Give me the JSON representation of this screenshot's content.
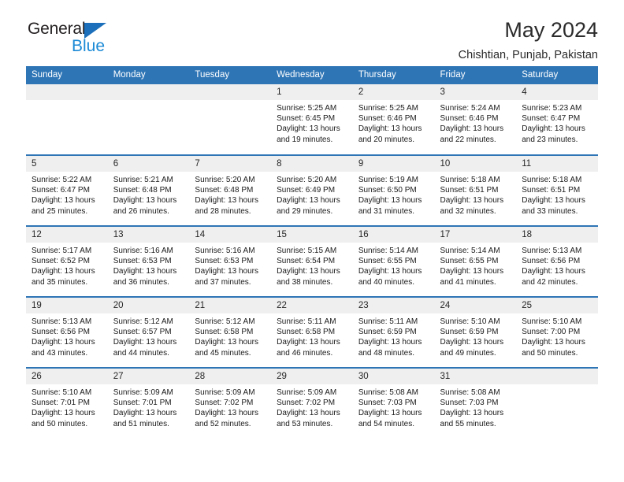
{
  "brand": {
    "name_top": "General",
    "name_bottom": "Blue",
    "triangle_color": "#1c6fba",
    "blue_text_color": "#1c8ad6"
  },
  "header": {
    "title": "May 2024",
    "location": "Chishtian, Punjab, Pakistan"
  },
  "theme": {
    "header_blue": "#2e75b6",
    "daynum_background": "#efefef",
    "text_color": "#1a1a1a"
  },
  "weekday_headers": [
    "Sunday",
    "Monday",
    "Tuesday",
    "Wednesday",
    "Thursday",
    "Friday",
    "Saturday"
  ],
  "labels": {
    "sunrise_prefix": "Sunrise:",
    "sunset_prefix": "Sunset:",
    "daylight_prefix": "Daylight:"
  },
  "weeks": [
    [
      {
        "day": "",
        "empty": true
      },
      {
        "day": "",
        "empty": true
      },
      {
        "day": "",
        "empty": true
      },
      {
        "day": "1",
        "sunrise": "Sunrise: 5:25 AM",
        "sunset": "Sunset: 6:45 PM",
        "daylight_line1": "Daylight: 13 hours",
        "daylight_line2": "and 19 minutes."
      },
      {
        "day": "2",
        "sunrise": "Sunrise: 5:25 AM",
        "sunset": "Sunset: 6:46 PM",
        "daylight_line1": "Daylight: 13 hours",
        "daylight_line2": "and 20 minutes."
      },
      {
        "day": "3",
        "sunrise": "Sunrise: 5:24 AM",
        "sunset": "Sunset: 6:46 PM",
        "daylight_line1": "Daylight: 13 hours",
        "daylight_line2": "and 22 minutes."
      },
      {
        "day": "4",
        "sunrise": "Sunrise: 5:23 AM",
        "sunset": "Sunset: 6:47 PM",
        "daylight_line1": "Daylight: 13 hours",
        "daylight_line2": "and 23 minutes."
      }
    ],
    [
      {
        "day": "5",
        "sunrise": "Sunrise: 5:22 AM",
        "sunset": "Sunset: 6:47 PM",
        "daylight_line1": "Daylight: 13 hours",
        "daylight_line2": "and 25 minutes."
      },
      {
        "day": "6",
        "sunrise": "Sunrise: 5:21 AM",
        "sunset": "Sunset: 6:48 PM",
        "daylight_line1": "Daylight: 13 hours",
        "daylight_line2": "and 26 minutes."
      },
      {
        "day": "7",
        "sunrise": "Sunrise: 5:20 AM",
        "sunset": "Sunset: 6:48 PM",
        "daylight_line1": "Daylight: 13 hours",
        "daylight_line2": "and 28 minutes."
      },
      {
        "day": "8",
        "sunrise": "Sunrise: 5:20 AM",
        "sunset": "Sunset: 6:49 PM",
        "daylight_line1": "Daylight: 13 hours",
        "daylight_line2": "and 29 minutes."
      },
      {
        "day": "9",
        "sunrise": "Sunrise: 5:19 AM",
        "sunset": "Sunset: 6:50 PM",
        "daylight_line1": "Daylight: 13 hours",
        "daylight_line2": "and 31 minutes."
      },
      {
        "day": "10",
        "sunrise": "Sunrise: 5:18 AM",
        "sunset": "Sunset: 6:51 PM",
        "daylight_line1": "Daylight: 13 hours",
        "daylight_line2": "and 32 minutes."
      },
      {
        "day": "11",
        "sunrise": "Sunrise: 5:18 AM",
        "sunset": "Sunset: 6:51 PM",
        "daylight_line1": "Daylight: 13 hours",
        "daylight_line2": "and 33 minutes."
      }
    ],
    [
      {
        "day": "12",
        "sunrise": "Sunrise: 5:17 AM",
        "sunset": "Sunset: 6:52 PM",
        "daylight_line1": "Daylight: 13 hours",
        "daylight_line2": "and 35 minutes."
      },
      {
        "day": "13",
        "sunrise": "Sunrise: 5:16 AM",
        "sunset": "Sunset: 6:53 PM",
        "daylight_line1": "Daylight: 13 hours",
        "daylight_line2": "and 36 minutes."
      },
      {
        "day": "14",
        "sunrise": "Sunrise: 5:16 AM",
        "sunset": "Sunset: 6:53 PM",
        "daylight_line1": "Daylight: 13 hours",
        "daylight_line2": "and 37 minutes."
      },
      {
        "day": "15",
        "sunrise": "Sunrise: 5:15 AM",
        "sunset": "Sunset: 6:54 PM",
        "daylight_line1": "Daylight: 13 hours",
        "daylight_line2": "and 38 minutes."
      },
      {
        "day": "16",
        "sunrise": "Sunrise: 5:14 AM",
        "sunset": "Sunset: 6:55 PM",
        "daylight_line1": "Daylight: 13 hours",
        "daylight_line2": "and 40 minutes."
      },
      {
        "day": "17",
        "sunrise": "Sunrise: 5:14 AM",
        "sunset": "Sunset: 6:55 PM",
        "daylight_line1": "Daylight: 13 hours",
        "daylight_line2": "and 41 minutes."
      },
      {
        "day": "18",
        "sunrise": "Sunrise: 5:13 AM",
        "sunset": "Sunset: 6:56 PM",
        "daylight_line1": "Daylight: 13 hours",
        "daylight_line2": "and 42 minutes."
      }
    ],
    [
      {
        "day": "19",
        "sunrise": "Sunrise: 5:13 AM",
        "sunset": "Sunset: 6:56 PM",
        "daylight_line1": "Daylight: 13 hours",
        "daylight_line2": "and 43 minutes."
      },
      {
        "day": "20",
        "sunrise": "Sunrise: 5:12 AM",
        "sunset": "Sunset: 6:57 PM",
        "daylight_line1": "Daylight: 13 hours",
        "daylight_line2": "and 44 minutes."
      },
      {
        "day": "21",
        "sunrise": "Sunrise: 5:12 AM",
        "sunset": "Sunset: 6:58 PM",
        "daylight_line1": "Daylight: 13 hours",
        "daylight_line2": "and 45 minutes."
      },
      {
        "day": "22",
        "sunrise": "Sunrise: 5:11 AM",
        "sunset": "Sunset: 6:58 PM",
        "daylight_line1": "Daylight: 13 hours",
        "daylight_line2": "and 46 minutes."
      },
      {
        "day": "23",
        "sunrise": "Sunrise: 5:11 AM",
        "sunset": "Sunset: 6:59 PM",
        "daylight_line1": "Daylight: 13 hours",
        "daylight_line2": "and 48 minutes."
      },
      {
        "day": "24",
        "sunrise": "Sunrise: 5:10 AM",
        "sunset": "Sunset: 6:59 PM",
        "daylight_line1": "Daylight: 13 hours",
        "daylight_line2": "and 49 minutes."
      },
      {
        "day": "25",
        "sunrise": "Sunrise: 5:10 AM",
        "sunset": "Sunset: 7:00 PM",
        "daylight_line1": "Daylight: 13 hours",
        "daylight_line2": "and 50 minutes."
      }
    ],
    [
      {
        "day": "26",
        "sunrise": "Sunrise: 5:10 AM",
        "sunset": "Sunset: 7:01 PM",
        "daylight_line1": "Daylight: 13 hours",
        "daylight_line2": "and 50 minutes."
      },
      {
        "day": "27",
        "sunrise": "Sunrise: 5:09 AM",
        "sunset": "Sunset: 7:01 PM",
        "daylight_line1": "Daylight: 13 hours",
        "daylight_line2": "and 51 minutes."
      },
      {
        "day": "28",
        "sunrise": "Sunrise: 5:09 AM",
        "sunset": "Sunset: 7:02 PM",
        "daylight_line1": "Daylight: 13 hours",
        "daylight_line2": "and 52 minutes."
      },
      {
        "day": "29",
        "sunrise": "Sunrise: 5:09 AM",
        "sunset": "Sunset: 7:02 PM",
        "daylight_line1": "Daylight: 13 hours",
        "daylight_line2": "and 53 minutes."
      },
      {
        "day": "30",
        "sunrise": "Sunrise: 5:08 AM",
        "sunset": "Sunset: 7:03 PM",
        "daylight_line1": "Daylight: 13 hours",
        "daylight_line2": "and 54 minutes."
      },
      {
        "day": "31",
        "sunrise": "Sunrise: 5:08 AM",
        "sunset": "Sunset: 7:03 PM",
        "daylight_line1": "Daylight: 13 hours",
        "daylight_line2": "and 55 minutes."
      },
      {
        "day": "",
        "empty": true
      }
    ]
  ]
}
